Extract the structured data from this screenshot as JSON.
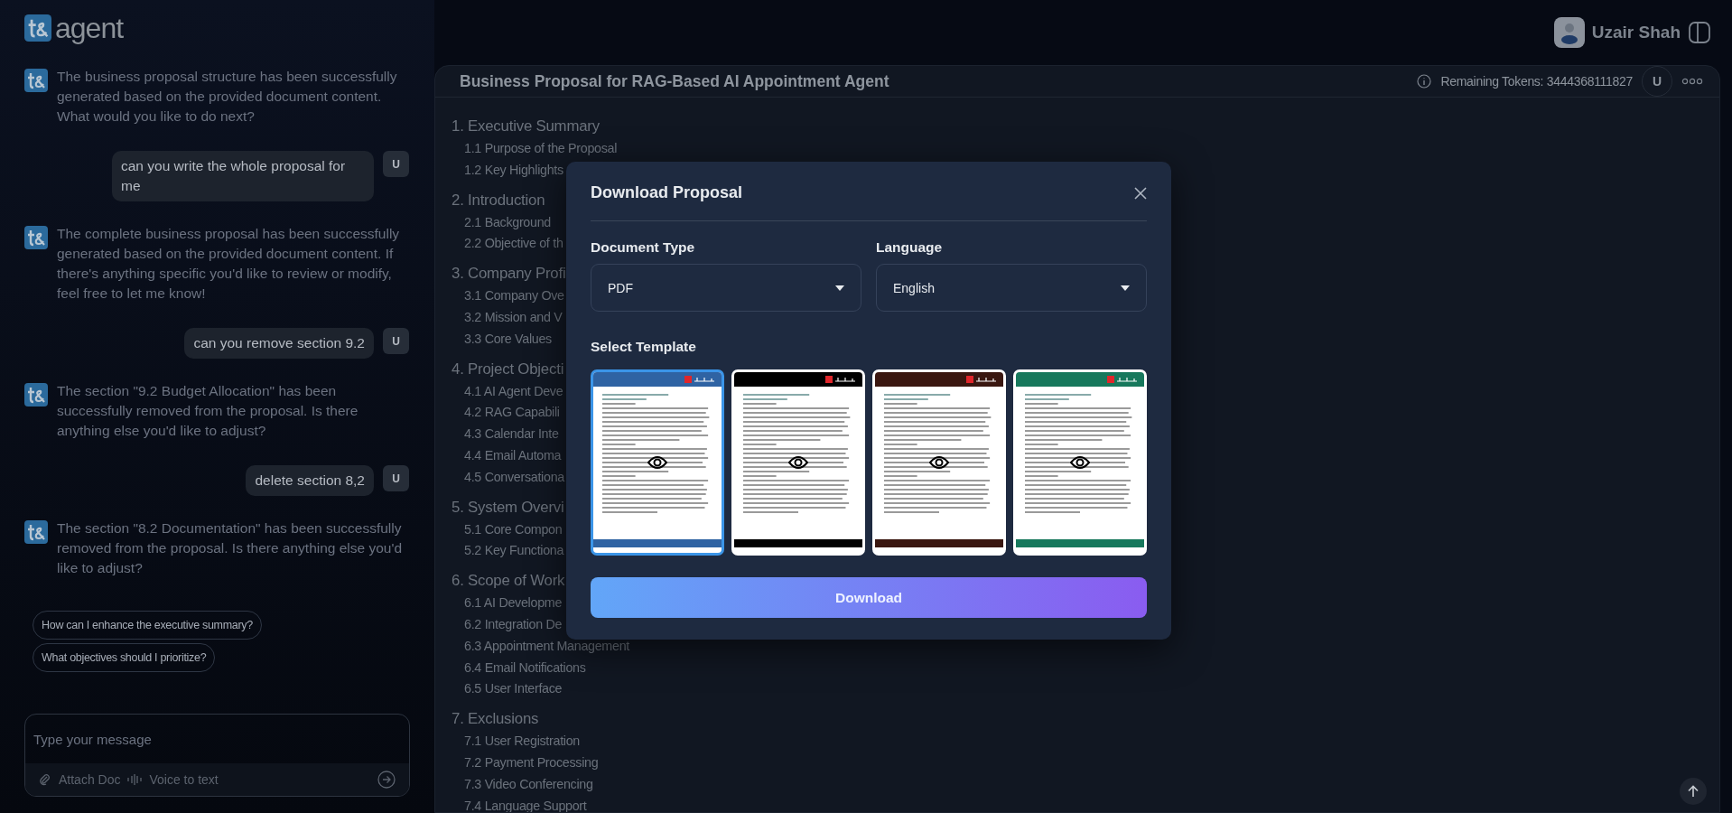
{
  "header": {
    "logo_text": "agent",
    "user_name": "Uzair Shah"
  },
  "chat": {
    "messages": [
      {
        "kind": "bot",
        "text": "The business proposal structure has been successfully generated based on the provided document content. What would you like to do next?"
      },
      {
        "kind": "user",
        "text": "can you write the whole proposal for me",
        "avatar": "U"
      },
      {
        "kind": "bot",
        "text": "The complete business proposal has been successfully generated based on the provided document content. If there's anything specific you'd like to review or modify, feel free to let me know!"
      },
      {
        "kind": "user",
        "text": "can you remove section 9.2",
        "avatar": "U"
      },
      {
        "kind": "bot",
        "text": "The section \"9.2 Budget Allocation\" has been successfully removed from the proposal. Is there anything else you'd like to adjust?"
      },
      {
        "kind": "user",
        "text": "delete section 8,2",
        "avatar": "U"
      },
      {
        "kind": "bot",
        "text": "The section \"8.2 Documentation\" has been successfully removed from the proposal. Is there anything else you'd like to adjust?"
      }
    ],
    "suggestions": [
      "How can I enhance the executive summary?",
      "What objectives should I prioritize?"
    ],
    "composer": {
      "placeholder": "Type your message",
      "attach_label": "Attach Doc",
      "voice_label": "Voice to text"
    }
  },
  "document": {
    "title": "Business Proposal for RAG-Based AI Appointment Agent",
    "remaining_tokens": "Remaining Tokens: 3444368111827",
    "avatar": "U",
    "outline": [
      {
        "title": "1. Executive Summary",
        "children": [
          {
            "title": "1.1 Purpose of the Proposal"
          },
          {
            "title": "1.2 Key Highlights"
          }
        ]
      },
      {
        "title": "2. Introduction",
        "children": [
          {
            "title": "2.1 Background"
          },
          {
            "title": "2.2 Objective of th"
          }
        ]
      },
      {
        "title": "3. Company Profi",
        "children": [
          {
            "title": "3.1 Company Ove"
          },
          {
            "title": "3.2 Mission and V"
          },
          {
            "title": "3.3 Core Values"
          }
        ]
      },
      {
        "title": "4. Project Objecti",
        "children": [
          {
            "title": "4.1 AI Agent Deve"
          },
          {
            "title": "4.2 RAG Capabili"
          },
          {
            "title": "4.3 Calendar Inte"
          },
          {
            "title": "4.4 Email Automa"
          },
          {
            "title": "4.5 Conversationa"
          }
        ]
      },
      {
        "title": "5. System Overvi",
        "children": [
          {
            "title": "5.1 Core Compon"
          },
          {
            "title": "5.2 Key Functiona"
          }
        ]
      },
      {
        "title": "6. Scope of Work",
        "children": [
          {
            "title": "6.1 AI Developme"
          },
          {
            "title": "6.2 Integration De"
          },
          {
            "title": "6.3 Appointment Management"
          },
          {
            "title": "6.4 Email Notifications"
          },
          {
            "title": "6.5 User Interface"
          }
        ]
      },
      {
        "title": "7. Exclusions",
        "children": [
          {
            "title": "7.1 User Registration"
          },
          {
            "title": "7.2 Payment Processing"
          },
          {
            "title": "7.3 Video Conferencing"
          },
          {
            "title": "7.4 Language Support"
          }
        ]
      }
    ]
  },
  "modal": {
    "title": "Download Proposal",
    "fields": [
      {
        "label": "Document Type",
        "value": "PDF"
      },
      {
        "label": "Language",
        "value": "English"
      }
    ],
    "template_label": "Select Template",
    "templates": [
      {
        "color": "#2f63a3",
        "selected": true
      },
      {
        "color": "#000000",
        "selected": false
      },
      {
        "color": "#3a1710",
        "selected": false
      },
      {
        "color": "#17785c",
        "selected": false
      }
    ],
    "download_label": "Download"
  }
}
